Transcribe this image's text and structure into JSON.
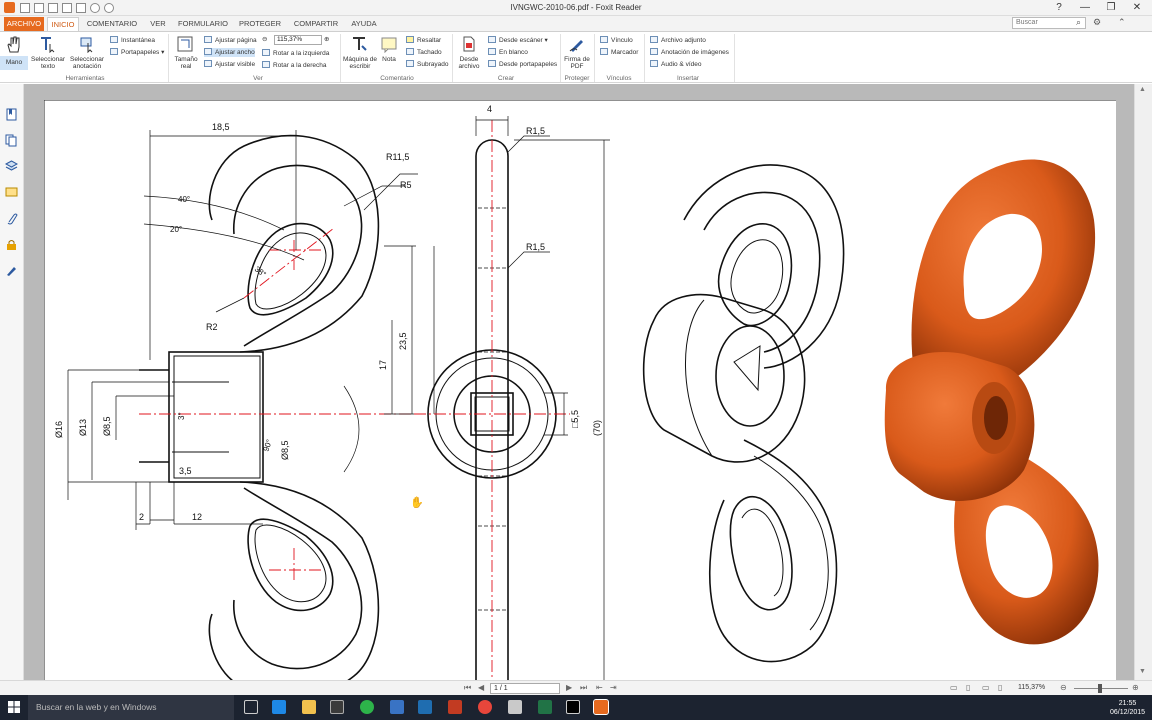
{
  "window": {
    "title": "IVNGWC-2010-06.pdf - Foxit Reader",
    "controls": [
      "?",
      "—",
      "❐",
      "✕"
    ]
  },
  "tabs": [
    {
      "label": "ARCHIVO"
    },
    {
      "label": "INICIO"
    },
    {
      "label": "COMENTARIO"
    },
    {
      "label": "VER"
    },
    {
      "label": "FORMULARIO"
    },
    {
      "label": "PROTEGER"
    },
    {
      "label": "COMPARTIR"
    },
    {
      "label": "AYUDA"
    }
  ],
  "search": {
    "placeholder": "Buscar"
  },
  "ribbon": {
    "herramientas": {
      "group": "Herramientas",
      "mano": "Mano",
      "seleccionar_texto": "Seleccionar texto",
      "seleccionar_anotacion": "Seleccionar anotación",
      "instantanea": "Instantánea",
      "portapapeles": "Portapapeles"
    },
    "ver": {
      "group": "Ver",
      "tamano_real": "Tamaño real",
      "ajustar_pagina": "Ajustar página",
      "ajustar_ancho": "Ajustar ancho",
      "ajustar_visible": "Ajustar visible",
      "zoom": "115,37%",
      "rotar_izq": "Rotar a la izquierda",
      "rotar_der": "Rotar a la derecha"
    },
    "comentario": {
      "group": "Comentario",
      "maquina": "Máquina de escribir",
      "nota": "Nota",
      "resaltar": "Resaltar",
      "tachado": "Tachado",
      "subrayado": "Subrayado"
    },
    "crear": {
      "group": "Crear",
      "desde_archivo": "Desde archivo",
      "desde_escaner": "Desde escáner",
      "en_blanco": "En blanco",
      "desde_portapapeles": "Desde portapapeles"
    },
    "proteger": {
      "group": "Proteger",
      "firma": "Firma de PDF"
    },
    "vinculos": {
      "group": "Vínculos",
      "vinculo": "Vínculo",
      "marcador": "Marcador"
    },
    "insertar": {
      "group": "Insertar",
      "archivo_adjunto": "Archivo adjunto",
      "anotacion_imagenes": "Anotación de imágenes",
      "audio_video": "Audio & vídeo"
    }
  },
  "drawing": {
    "dims": {
      "d18_5": "18,5",
      "r11_5": "R11,5",
      "r5": "R5",
      "a40": "40°",
      "a20": "20°",
      "a38": "38°",
      "r2": "R2",
      "d23_5": "23,5",
      "d17": "17",
      "d16": "Ø16",
      "d13": "Ø13",
      "d8_5a": "Ø8,5",
      "a3": "3°",
      "a90": "90°",
      "d8_5b": "Ø8,5",
      "d3_5": "3,5",
      "d2": "2",
      "d12": "12",
      "d4": "4",
      "r1_5a": "R1,5",
      "r1_5b": "R1,5",
      "sq5_5": "□5,5",
      "d70": "(70)"
    }
  },
  "statusbar": {
    "page": "1 / 1",
    "zoom": "115,37%"
  },
  "taskbar": {
    "search_placeholder": "Buscar en la web y en Windows",
    "time": "21:55",
    "date": "06/12/2015"
  },
  "colors": {
    "accent": "#e66a1f",
    "render_orange": "#d95a1a",
    "centerline": "#e0141e"
  }
}
